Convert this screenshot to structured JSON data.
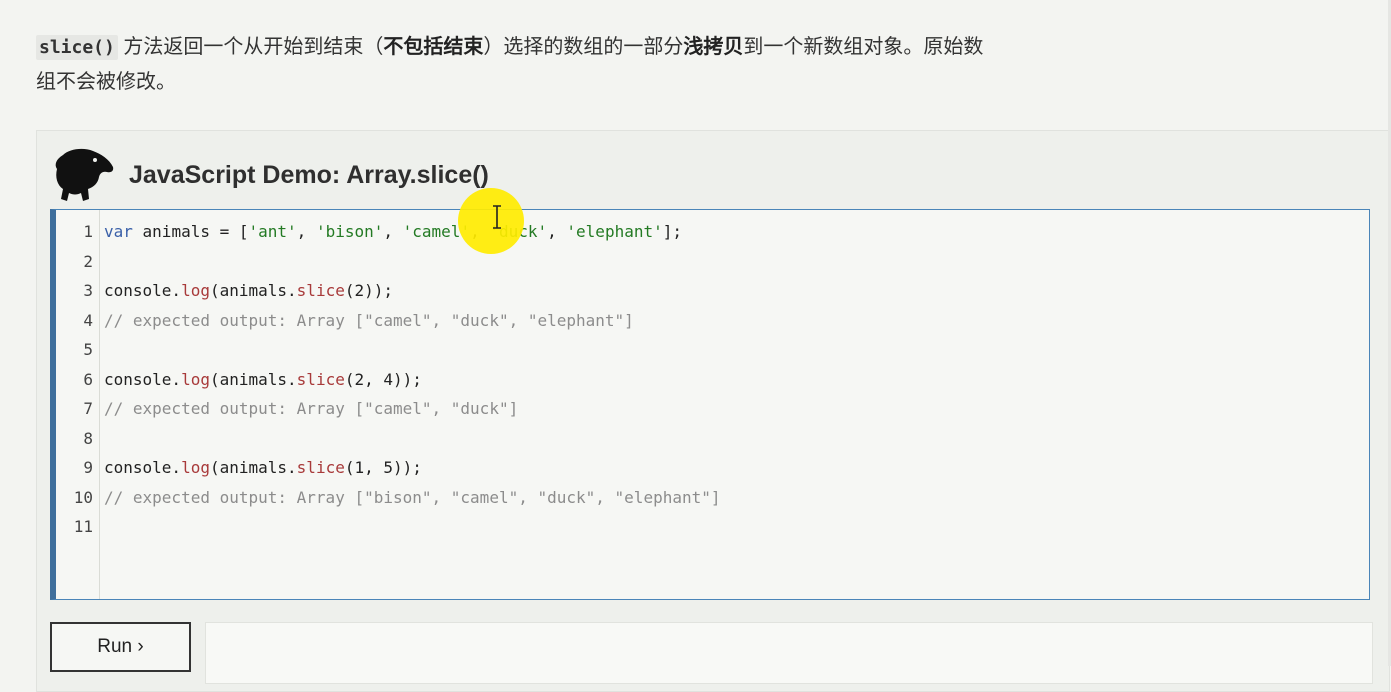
{
  "description": {
    "method_code": "slice()",
    "text_1": " 方法返回一个从开始到结束（",
    "bold_1": "不包括结束",
    "text_2": "）选择的数组的一部分",
    "bold_2": "浅拷贝",
    "text_3": "到一个新数组对象。原始数组不会被修改。"
  },
  "demo": {
    "title": "JavaScript Demo: Array.slice()",
    "logo_icon": "dinosaur-logo-icon",
    "run_label": "Run ›"
  },
  "editor": {
    "lines": [
      {
        "n": "1",
        "tokens": [
          {
            "t": "kw",
            "v": "var"
          },
          {
            "t": "",
            "v": " animals = ["
          },
          {
            "t": "str",
            "v": "'ant'"
          },
          {
            "t": "",
            "v": ", "
          },
          {
            "t": "str",
            "v": "'bison'"
          },
          {
            "t": "",
            "v": ", "
          },
          {
            "t": "str",
            "v": "'camel'"
          },
          {
            "t": "",
            "v": ", "
          },
          {
            "t": "str",
            "v": "'duck'"
          },
          {
            "t": "",
            "v": ", "
          },
          {
            "t": "str",
            "v": "'elephant'"
          },
          {
            "t": "",
            "v": "];"
          }
        ]
      },
      {
        "n": "2",
        "tokens": []
      },
      {
        "n": "3",
        "tokens": [
          {
            "t": "",
            "v": "console."
          },
          {
            "t": "fn",
            "v": "log"
          },
          {
            "t": "",
            "v": "(animals."
          },
          {
            "t": "fn",
            "v": "slice"
          },
          {
            "t": "",
            "v": "(2));"
          }
        ]
      },
      {
        "n": "4",
        "tokens": [
          {
            "t": "cm",
            "v": "// expected output: Array [\"camel\", \"duck\", \"elephant\"]"
          }
        ]
      },
      {
        "n": "5",
        "tokens": []
      },
      {
        "n": "6",
        "tokens": [
          {
            "t": "",
            "v": "console."
          },
          {
            "t": "fn",
            "v": "log"
          },
          {
            "t": "",
            "v": "(animals."
          },
          {
            "t": "fn",
            "v": "slice"
          },
          {
            "t": "",
            "v": "(2, 4));"
          }
        ]
      },
      {
        "n": "7",
        "tokens": [
          {
            "t": "cm",
            "v": "// expected output: Array [\"camel\", \"duck\"]"
          }
        ]
      },
      {
        "n": "8",
        "tokens": []
      },
      {
        "n": "9",
        "tokens": [
          {
            "t": "",
            "v": "console."
          },
          {
            "t": "fn",
            "v": "log"
          },
          {
            "t": "",
            "v": "(animals."
          },
          {
            "t": "fn",
            "v": "slice"
          },
          {
            "t": "",
            "v": "(1, 5));"
          }
        ]
      },
      {
        "n": "10",
        "tokens": [
          {
            "t": "cm",
            "v": "// expected output: Array [\"bison\", \"camel\", \"duck\", \"elephant\"]"
          }
        ]
      },
      {
        "n": "11",
        "tokens": []
      }
    ]
  },
  "colors": {
    "editor_border": "#3f6f9c",
    "cursor_highlight": "#ffec00"
  }
}
